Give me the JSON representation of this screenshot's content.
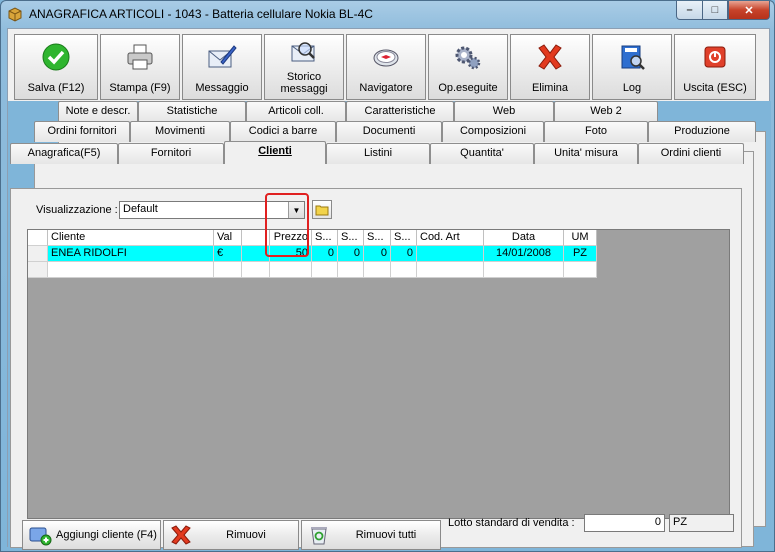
{
  "window": {
    "title": "ANAGRAFICA ARTICOLI - 1043 - Batteria cellulare Nokia BL-4C",
    "min_label": "–",
    "max_label": "□",
    "close_label": "✕"
  },
  "toolbar": {
    "save": "Salva (F12)",
    "print": "Stampa (F9)",
    "message": "Messaggio",
    "history_line1": "Storico",
    "history_line2": "messaggi",
    "navigator": "Navigatore",
    "operations": "Op.eseguite",
    "delete": "Elimina",
    "log": "Log",
    "exit": "Uscita (ESC)"
  },
  "tabs": {
    "row1": [
      "Note e descr.",
      "Statistiche",
      "Articoli coll.",
      "Caratteristiche",
      "Web",
      "Web 2"
    ],
    "row2": [
      "Ordini fornitori",
      "Movimenti",
      "Codici a barre",
      "Documenti",
      "Composizioni",
      "Foto",
      "Produzione"
    ],
    "row3": [
      "Anagrafica(F5)",
      "Fornitori",
      "Clienti",
      "Listini",
      "Quantita'",
      "Unita' misura",
      "Ordini clienti"
    ],
    "active": "Clienti"
  },
  "view": {
    "label": "Visualizzazione :",
    "selected": "Default"
  },
  "grid": {
    "headers": [
      "Cliente",
      "Val",
      "",
      "Prezzo",
      "S...",
      "S...",
      "S...",
      "S...",
      "Cod. Art",
      "Data",
      "UM"
    ],
    "rows": [
      [
        "ENEA RIDOLFI",
        "€",
        "",
        "50",
        "0",
        "0",
        "0",
        "0",
        "",
        "14/01/2008",
        "PZ"
      ]
    ]
  },
  "actions": {
    "add_client": "Aggiungi cliente (F4)",
    "remove": "Rimuovi",
    "remove_all": "Rimuovi tutti"
  },
  "lotto": {
    "label": "Lotto standard di vendita :",
    "value": "0",
    "um": "PZ"
  },
  "colors": {
    "selected_row": "#00ffff",
    "highlight_box": "#e02020",
    "grid_background": "#a0a0a0"
  }
}
